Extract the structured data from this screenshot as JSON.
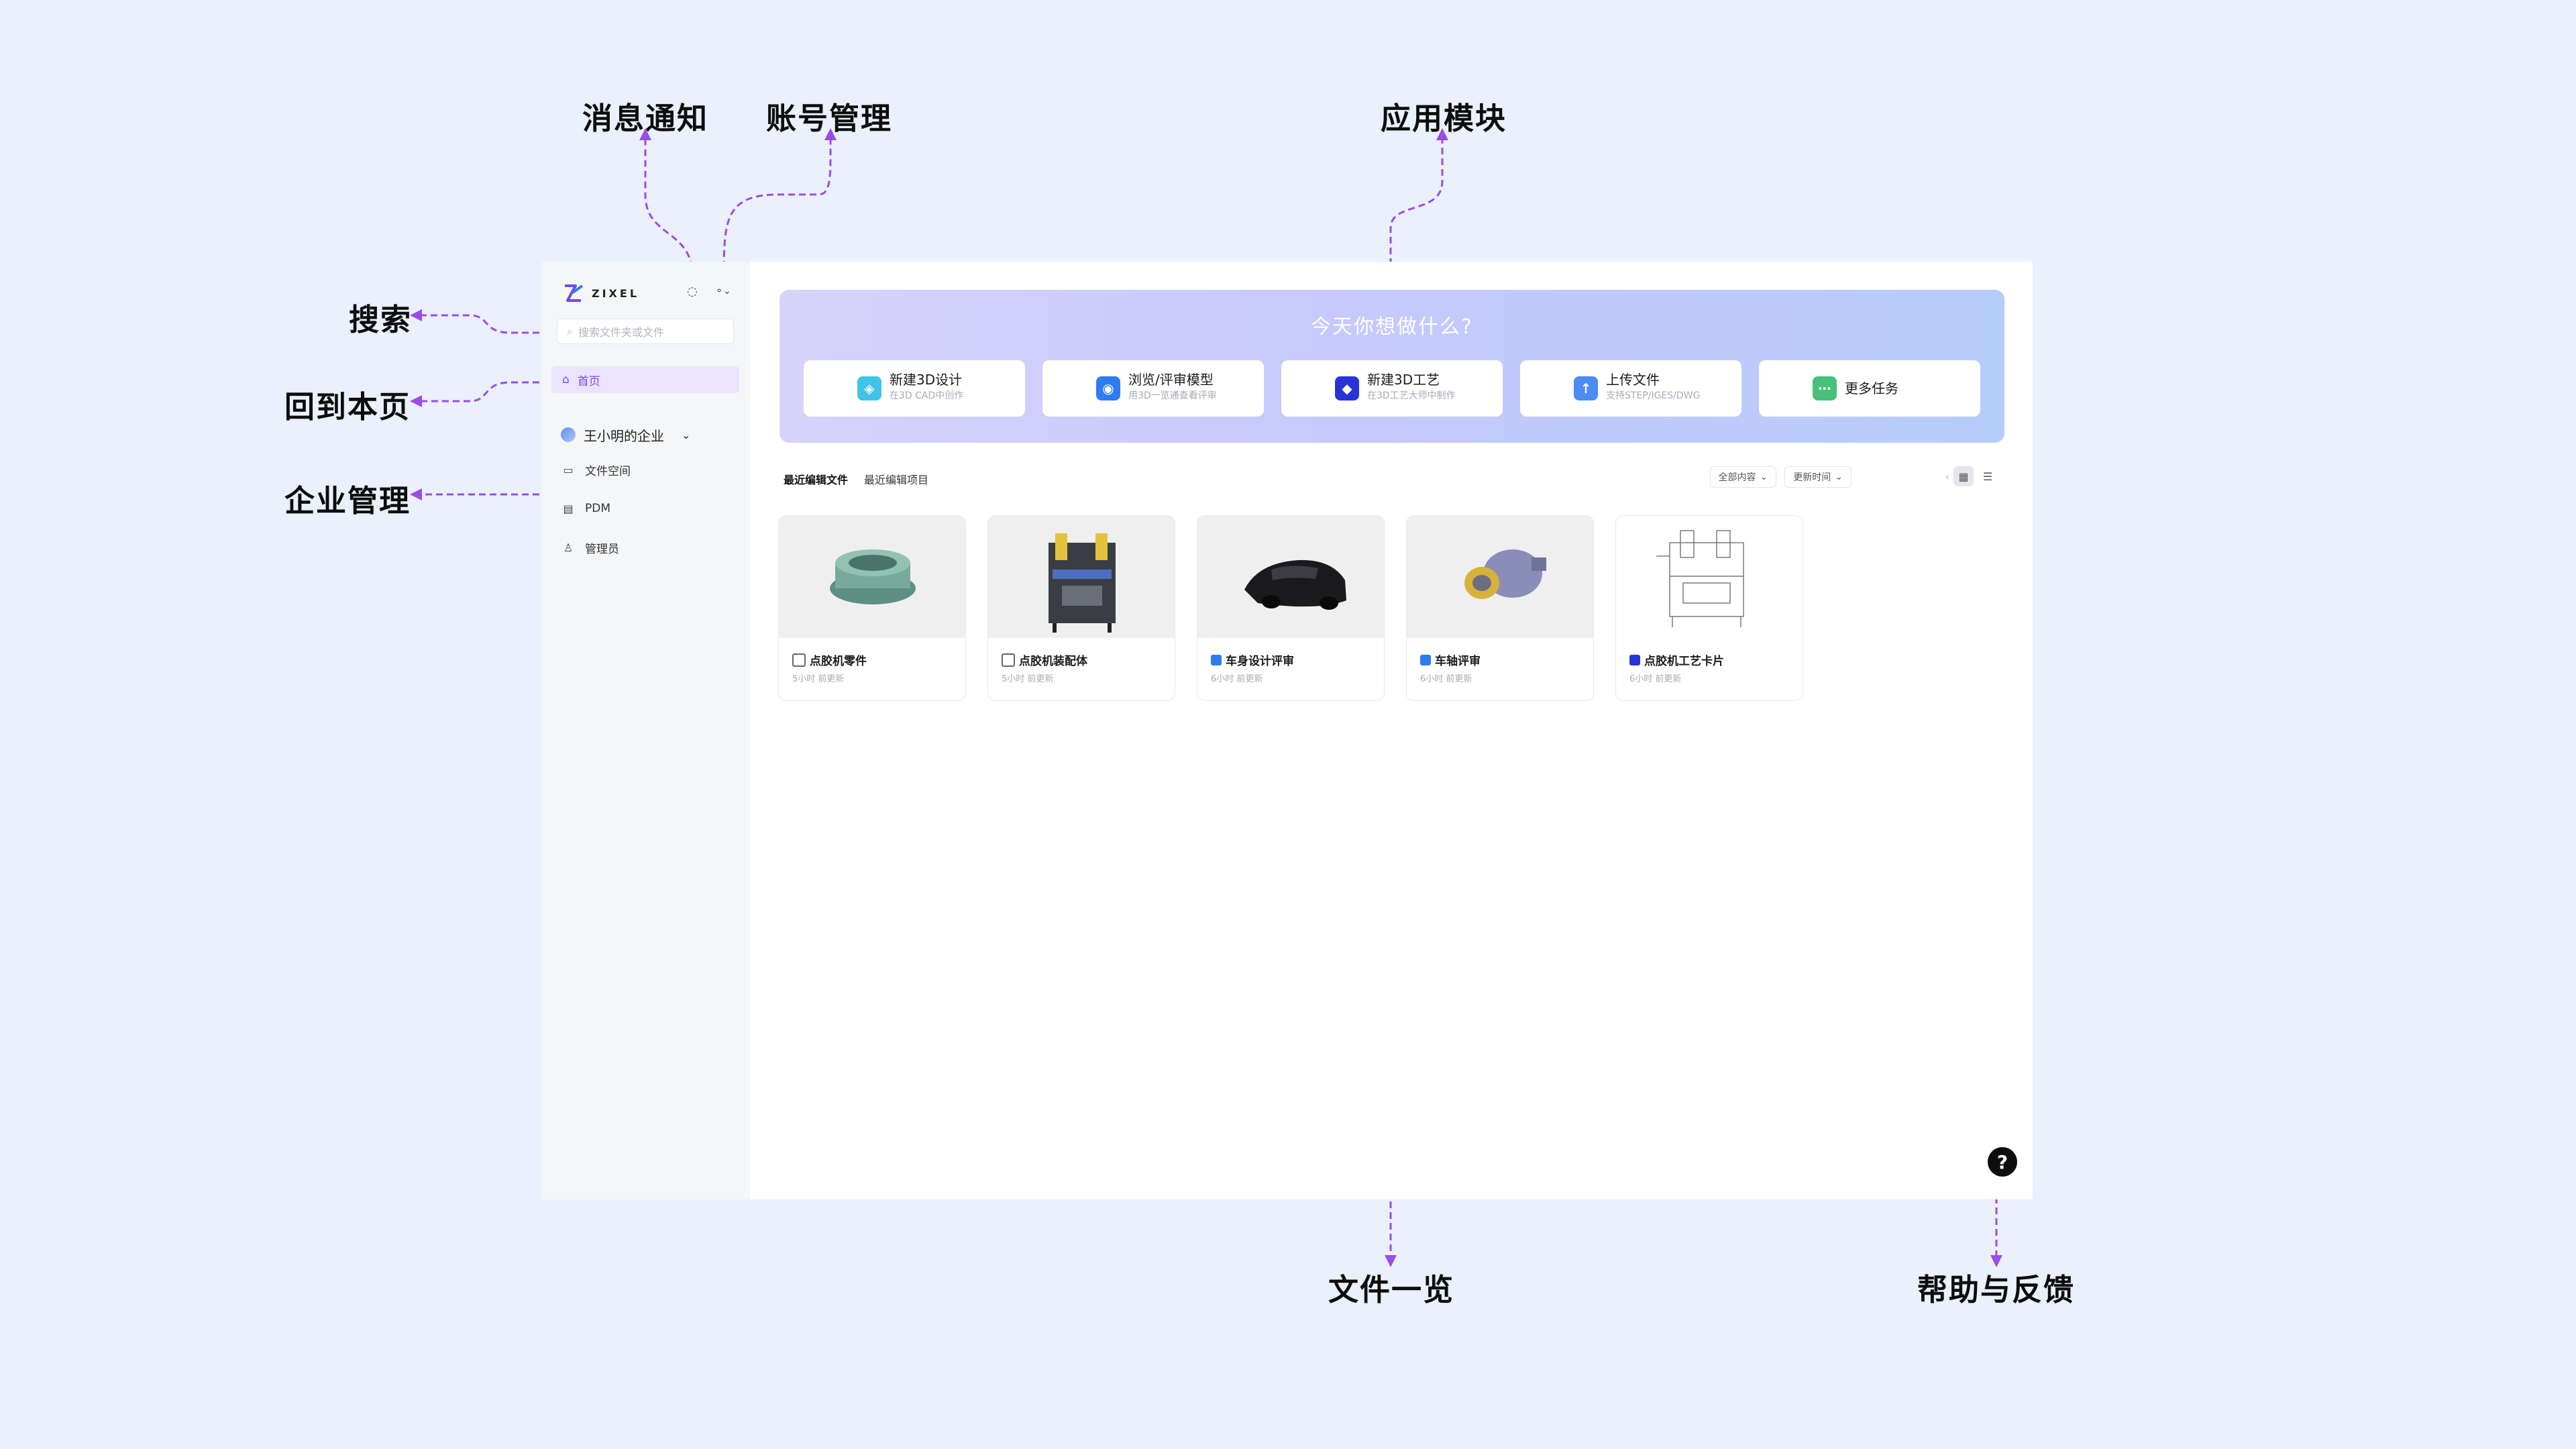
{
  "callouts": {
    "notifications": "消息通知",
    "account": "账号管理",
    "app_modules": "应用模块",
    "search": "搜索",
    "back_home": "回到本页",
    "enterprise": "企业管理",
    "file_overview": "文件一览",
    "help_feedback": "帮助与反馈"
  },
  "app": {
    "logo_text": "ZIXEL",
    "search_placeholder": "搜索文件夹或文件",
    "nav_home": "首页",
    "enterprise_name": "王小明的企业",
    "nav_items": [
      "文件空间",
      "PDM",
      "管理员"
    ]
  },
  "banner": {
    "title": "今天你想做什么?",
    "cards": [
      {
        "title": "新建3D设计",
        "sub": "在3D CAD中创作",
        "color": "#3fc3e8",
        "icon": "cube-icon"
      },
      {
        "title": "浏览/评审模型",
        "sub": "用3D一览通查看评审",
        "color": "#2f7cf0",
        "icon": "eye-cube-icon"
      },
      {
        "title": "新建3D工艺",
        "sub": "在3D工艺大师中制作",
        "color": "#2734d6",
        "icon": "process-icon"
      },
      {
        "title": "上传文件",
        "sub": "支持STEP/IGES/DWG",
        "color": "#4d8cf5",
        "icon": "upload-icon"
      },
      {
        "title": "更多任务",
        "sub": "",
        "color": "#47c07a",
        "icon": "more-icon"
      }
    ]
  },
  "recent": {
    "tabs": [
      "最近编辑文件",
      "最近编辑项目"
    ],
    "filter_content": "全部内容",
    "filter_time": "更新时间",
    "files": [
      {
        "name": "点胶机零件",
        "meta": "5小时 前更新",
        "icon_color": "#666666"
      },
      {
        "name": "点胶机装配体",
        "meta": "5小时 前更新",
        "icon_color": "#666666"
      },
      {
        "name": "车身设计评审",
        "meta": "6小时 前更新",
        "icon_color": "#2f7cf0"
      },
      {
        "name": "车轴评审",
        "meta": "6小时 前更新",
        "icon_color": "#2f7cf0"
      },
      {
        "name": "点胶机工艺卡片",
        "meta": "6小时 前更新",
        "icon_color": "#2734d6"
      }
    ]
  },
  "help_button": "?"
}
